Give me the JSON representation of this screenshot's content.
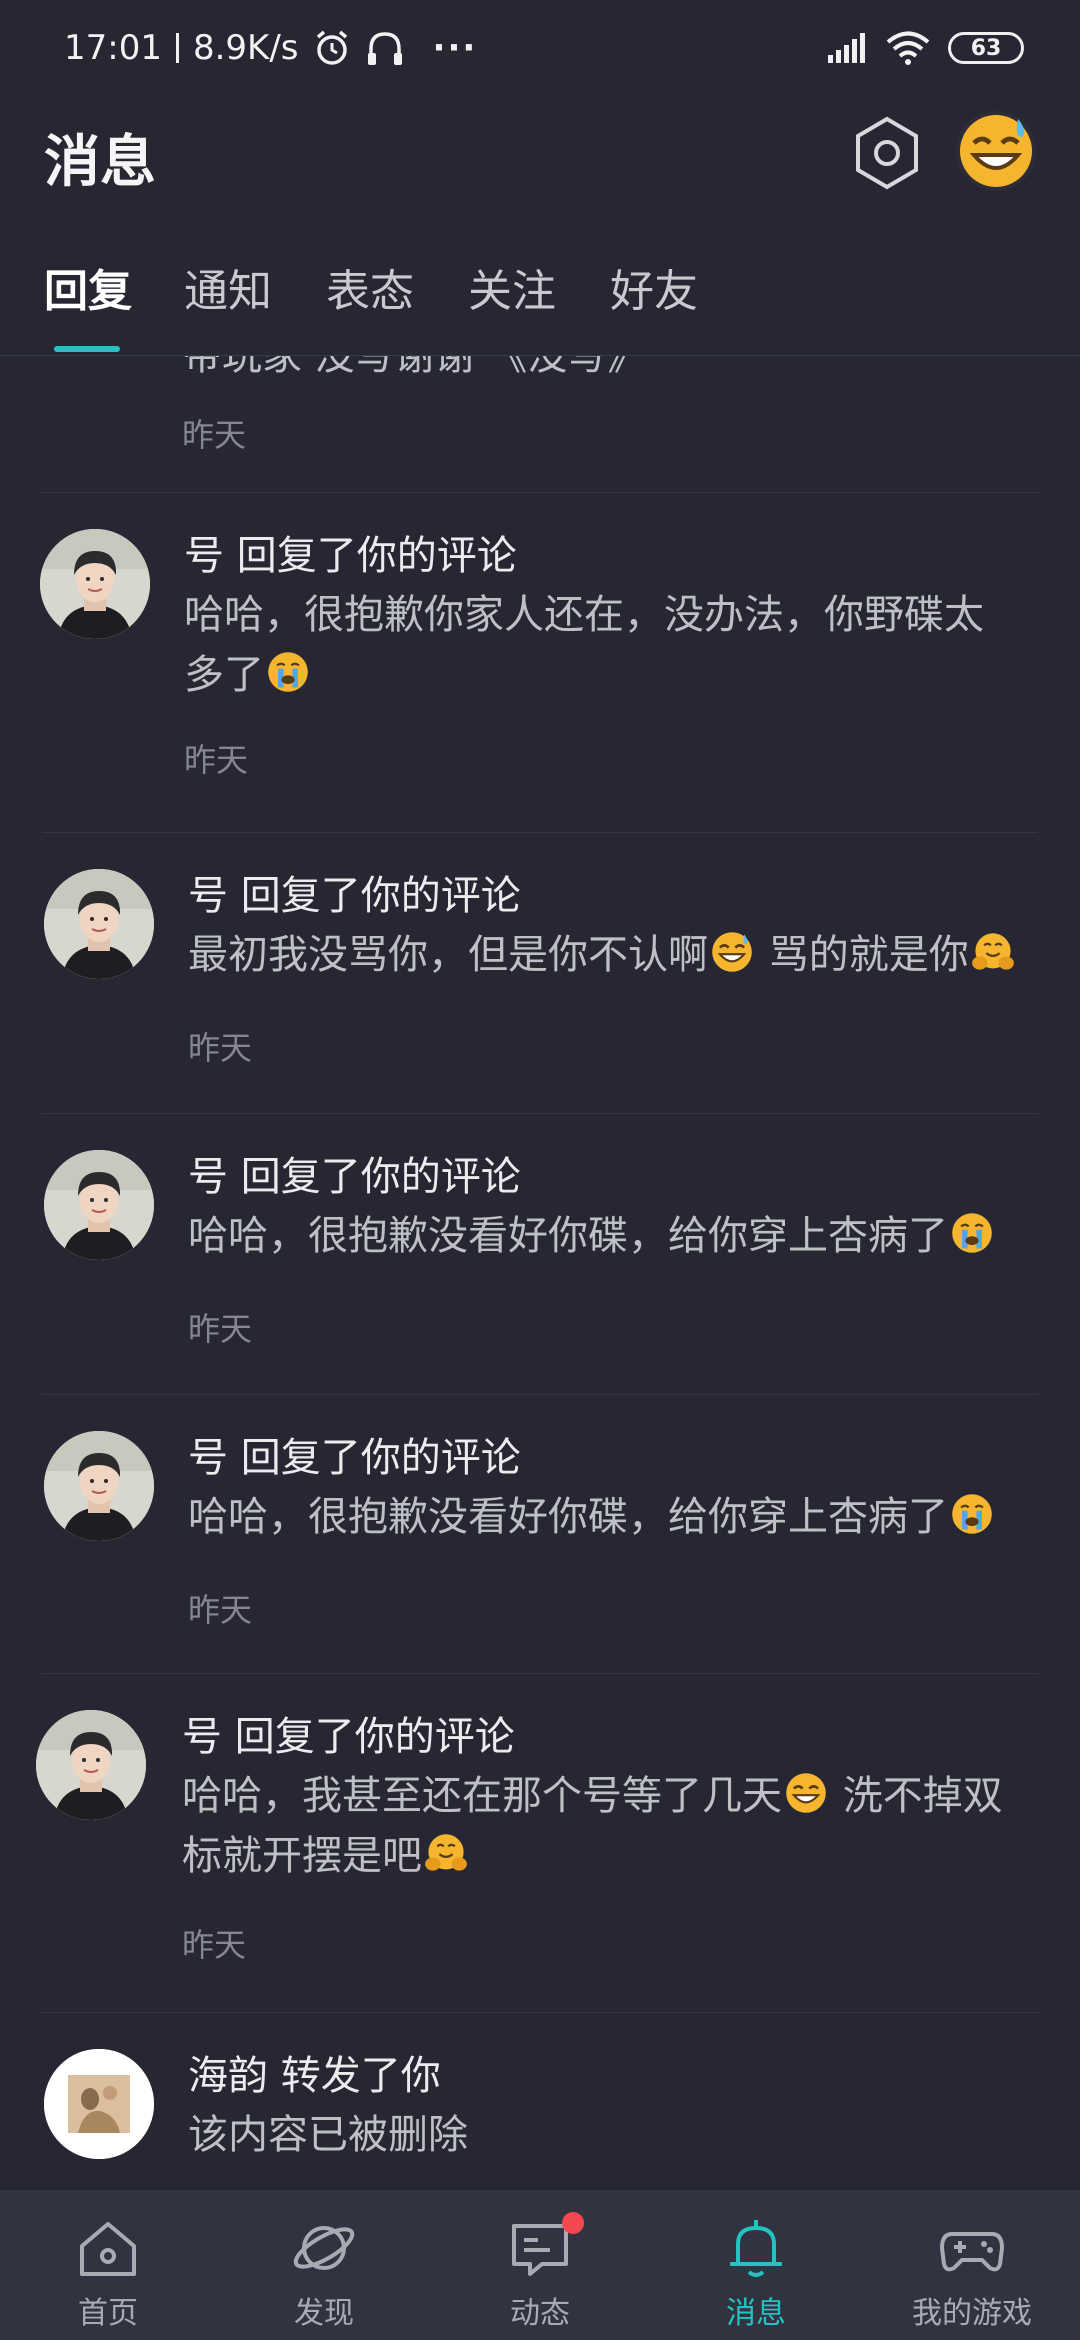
{
  "status_bar": {
    "time": "17:01",
    "speed": "8.9K/s",
    "more": "···",
    "battery": "63"
  },
  "header": {
    "title": "消息"
  },
  "tabs": [
    "回复",
    "通知",
    "表态",
    "关注",
    "好友"
  ],
  "feed": {
    "partial_item": {
      "text": "带玩家 没写谢谢 《没写》",
      "time": "昨天"
    },
    "items": [
      {
        "user": "号",
        "action": "回复了你的评论",
        "body": "哈哈，很抱歉你家人还在，没办法，你野碟太多了",
        "time": "昨天"
      },
      {
        "user": "号",
        "action": "回复了你的评论",
        "body_a": "最初我没骂你，但是你不认啊",
        "body_b": " 骂的就是你",
        "time": "昨天"
      },
      {
        "user": "号",
        "action": "回复了你的评论",
        "body": "哈哈，很抱歉没看好你碟，给你穿上杏病了",
        "time": "昨天"
      },
      {
        "user": "号",
        "action": "回复了你的评论",
        "body": "哈哈，很抱歉没看好你碟，给你穿上杏病了",
        "time": "昨天"
      },
      {
        "user": "号",
        "action": "回复了你的评论",
        "body_a": "哈哈，我甚至还在那个号等了几天",
        "body_b": " 洗不掉双标就开摆是吧",
        "time": "昨天"
      },
      {
        "user": "海韵",
        "action": "转发了你",
        "body": "该内容已被删除"
      }
    ]
  },
  "bottom_nav": [
    {
      "label": "首页",
      "icon": "home-icon"
    },
    {
      "label": "发现",
      "icon": "planet-icon"
    },
    {
      "label": "动态",
      "icon": "chat-icon"
    },
    {
      "label": "消息",
      "icon": "bell-icon"
    },
    {
      "label": "我的游戏",
      "icon": "gamepad-icon"
    }
  ],
  "colors": {
    "background": "#262733",
    "accent": "#25c2c2",
    "nav_background": "#323340",
    "badge": "#f5474f"
  }
}
